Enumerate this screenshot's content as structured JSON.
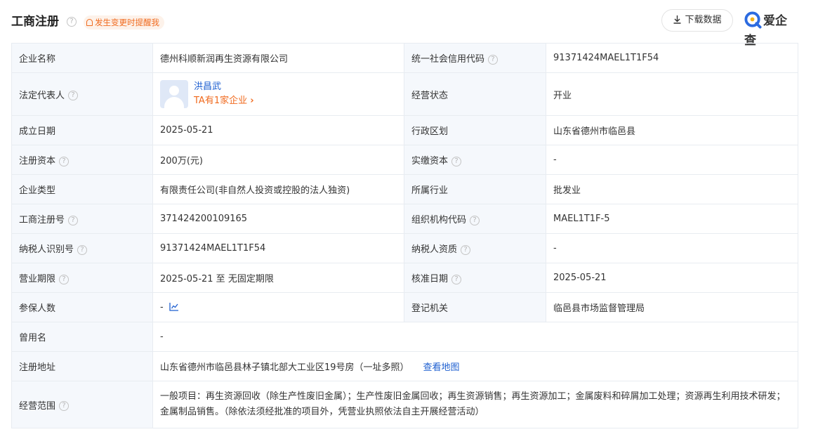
{
  "header": {
    "title": "工商注册",
    "title_help": "?",
    "alert": "发生变更时提醒我",
    "download_label": "下载数据",
    "brand": "爱企查"
  },
  "help_glyph": "?",
  "rows": {
    "company_name": {
      "label": "企业名称",
      "value": "德州科顺新润再生资源有限公司"
    },
    "credit_code": {
      "label": "统一社会信用代码",
      "value": "91371424MAEL1T1F54"
    },
    "legal_rep": {
      "label": "法定代表人",
      "name": "洪昌武",
      "companies": "TA有1家企业",
      "chevron": "›"
    },
    "status": {
      "label": "经营状态",
      "value": "开业"
    },
    "founded": {
      "label": "成立日期",
      "value": "2025-05-21"
    },
    "region": {
      "label": "行政区划",
      "value": "山东省德州市临邑县"
    },
    "reg_capital": {
      "label": "注册资本",
      "value": "200万(元)"
    },
    "paid_capital": {
      "label": "实缴资本",
      "value": "-"
    },
    "company_type": {
      "label": "企业类型",
      "value": "有限责任公司(非自然人投资或控股的法人独资)"
    },
    "industry": {
      "label": "所属行业",
      "value": "批发业"
    },
    "reg_number": {
      "label": "工商注册号",
      "value": "371424200109165"
    },
    "org_code": {
      "label": "组织机构代码",
      "value": "MAEL1T1F-5"
    },
    "taxpayer_id": {
      "label": "纳税人识别号",
      "value": "91371424MAEL1T1F54"
    },
    "taxpayer_qual": {
      "label": "纳税人资质",
      "value": "-"
    },
    "term": {
      "label": "营业期限",
      "value": "2025-05-21 至 无固定期限"
    },
    "approval_date": {
      "label": "核准日期",
      "value": "2025-05-21"
    },
    "insured": {
      "label": "参保人数",
      "value": "-"
    },
    "registry": {
      "label": "登记机关",
      "value": "临邑县市场监督管理局"
    },
    "former_name": {
      "label": "曾用名",
      "value": "-"
    },
    "address": {
      "label": "注册地址",
      "value": "山东省德州市临邑县林子镇北部大工业区19号房（一址多照）",
      "map_link": "查看地图"
    },
    "scope": {
      "label": "经营范围",
      "value": "一般项目：再生资源回收（除生产性废旧金属）；生产性废旧金属回收；再生资源销售；再生资源加工；金属废料和碎屑加工处理；资源再生利用技术研发；金属制品销售。（除依法须经批准的项目外，凭营业执照依法自主开展经营活动）"
    }
  }
}
